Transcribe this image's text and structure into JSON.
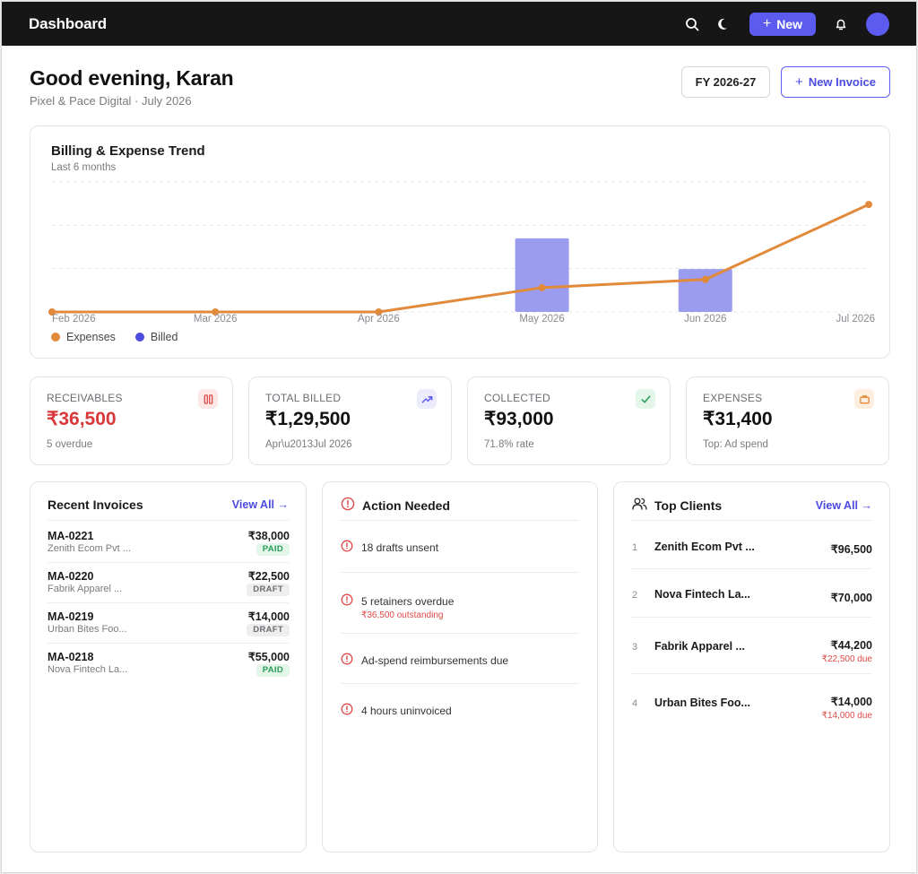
{
  "topbar": {
    "title": "Dashboard",
    "new_label": "New"
  },
  "header": {
    "greeting": "Good evening, Karan",
    "subtitle": "Pixel & Pace Digital · July 2026",
    "fy_label": "FY 2026-27",
    "new_invoice_label": "New Invoice"
  },
  "chart": {
    "title": "Billing & Expense Trend",
    "subtitle": "Last 6 months",
    "legend": {
      "expenses": "Expenses",
      "billed": "Billed"
    }
  },
  "chart_data": {
    "type": "bar",
    "categories": [
      "Feb 2026",
      "Mar 2026",
      "Apr 2026",
      "May 2026",
      "Jun 2026",
      "Jul 2026"
    ],
    "series": [
      {
        "name": "Billed",
        "type": "bar",
        "color": "#9b9bf0",
        "values": [
          0,
          0,
          0,
          85000,
          49500,
          0
        ]
      },
      {
        "name": "Expenses",
        "type": "line",
        "color": "#e08a3a",
        "values": [
          0,
          0,
          0,
          28000,
          37500,
          124000
        ]
      }
    ],
    "ylim": [
      0,
      150000
    ],
    "grid": true,
    "legend_position": "bottom-left"
  },
  "stats": [
    {
      "label": "RECEIVABLES",
      "value": "₹36,500",
      "note": "5 overdue",
      "icon": "pause-icon",
      "value_color": "#d9373a",
      "icon_color": "#e04848",
      "icon_bg": "#fde8e8"
    },
    {
      "label": "TOTAL BILLED",
      "value": "₹1,29,500",
      "note": "Apr\\u2013Jul 2026",
      "icon": "trend-up-icon",
      "value_color": "#111111",
      "icon_color": "#5b5bf0",
      "icon_bg": "#ececfd"
    },
    {
      "label": "COLLECTED",
      "value": "₹93,000",
      "note": "71.8% rate",
      "icon": "check-icon",
      "value_color": "#111111",
      "icon_color": "#2a9d5a",
      "icon_bg": "#e4f6ea"
    },
    {
      "label": "EXPENSES",
      "value": "₹31,400",
      "note": "Top: Ad spend",
      "icon": "briefcase-icon",
      "value_color": "#111111",
      "icon_color": "#e08a3a",
      "icon_bg": "#fdeee0"
    }
  ],
  "invoices": {
    "title": "Recent Invoices",
    "view_all": "View All →",
    "rows": [
      {
        "id": "MA-0221",
        "client": "Zenith Ecom Pvt ...",
        "amount": "₹38,000",
        "status": "PAID"
      },
      {
        "id": "MA-0220",
        "client": "Fabrik Apparel ...",
        "amount": "₹22,500",
        "status": "DRAFT"
      },
      {
        "id": "MA-0219",
        "client": "Urban Bites Foo...",
        "amount": "₹14,000",
        "status": "DRAFT"
      },
      {
        "id": "MA-0218",
        "client": "Nova Fintech La...",
        "amount": "₹55,000",
        "status": "PAID"
      }
    ]
  },
  "actions": {
    "title": "Action Needed",
    "items": [
      {
        "text": "18 drafts unsent",
        "sub": ""
      },
      {
        "text": "5 retainers overdue",
        "sub": "₹36,500 outstanding"
      },
      {
        "text": "Ad-spend reimbursements due",
        "sub": ""
      },
      {
        "text": "4 hours uninvoiced",
        "sub": ""
      }
    ]
  },
  "clients": {
    "title": "Top Clients",
    "view_all": "View All →",
    "rows": [
      {
        "rank": "1",
        "name": "Zenith Ecom Pvt ...",
        "amount": "₹96,500",
        "due": ""
      },
      {
        "rank": "2",
        "name": "Nova Fintech La...",
        "amount": "₹70,000",
        "due": ""
      },
      {
        "rank": "3",
        "name": "Fabrik Apparel ...",
        "amount": "₹44,200",
        "due": "₹22,500 due"
      },
      {
        "rank": "4",
        "name": "Urban Bites Foo...",
        "amount": "₹14,000",
        "due": "₹14,000 due"
      }
    ]
  },
  "colors": {
    "accent": "#5b5bf0",
    "danger": "#e04848",
    "success": "#2a9d5a",
    "orange": "#e08a3a"
  }
}
